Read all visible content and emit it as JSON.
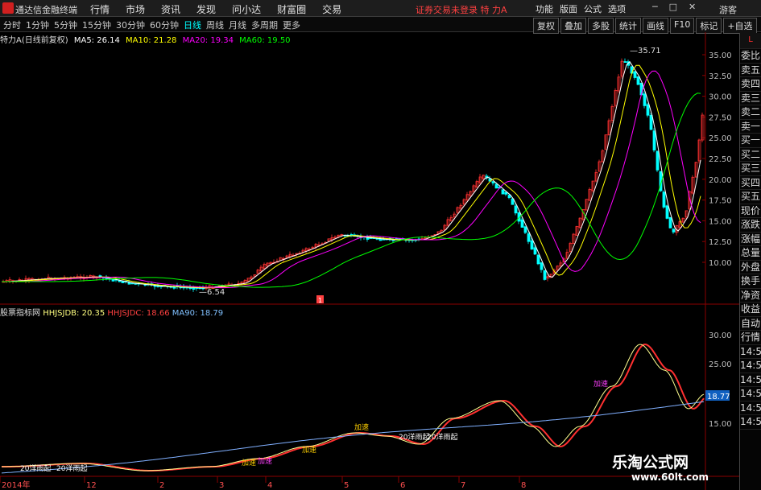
{
  "titlebar": {
    "app_name": "通达信金融终端",
    "menu": [
      "行情",
      "市场",
      "资讯",
      "发现",
      "问小达",
      "财富圈",
      "交易"
    ],
    "status": "证券交易未登录  特 力A",
    "right_tools": [
      "功能",
      "版面",
      "公式",
      "选项"
    ],
    "guest": "游客"
  },
  "periods": {
    "items": [
      "分时",
      "1分钟",
      "5分钟",
      "15分钟",
      "30分钟",
      "60分钟",
      "日线",
      "周线",
      "月线",
      "多周期",
      "更多"
    ],
    "active": "日线"
  },
  "toolbar": [
    "复权",
    "叠加",
    "多股",
    "统计",
    "画线",
    "F10",
    "标记",
    "+自选"
  ],
  "main_info": {
    "stock": "特力A(日线前复权)",
    "ma5": "MA5: 26.14",
    "ma10": "MA10: 21.28",
    "ma20": "MA20: 19.34",
    "ma60": "MA60: 19.50"
  },
  "indicator_info": {
    "name": "股票指标网",
    "hhjsjdb": "HHJSJDB: 20.35",
    "hhjsjdc": "HHJSJDC: 18.66",
    "ma90": "MA90: 18.79"
  },
  "price_axis": [
    "35.00",
    "32.50",
    "30.00",
    "27.50",
    "25.00",
    "22.50",
    "20.00",
    "17.50",
    "15.00",
    "12.50",
    "10.00"
  ],
  "indicator_axis": [
    "30.00",
    "25.00",
    "18.77",
    "15.00"
  ],
  "annotations": {
    "high": "35.71",
    "low": "6.54",
    "marker": "1"
  },
  "signal_labels": [
    "加速",
    "加速",
    "加速",
    "加速",
    "20洋雨起",
    "20洋雨起",
    "20洋雨起",
    "20洋雨起",
    "加速"
  ],
  "x_axis": [
    "2014年",
    "12",
    "2",
    "3",
    "4",
    "5",
    "6",
    "7",
    "8"
  ],
  "sidebar": [
    "L",
    "委比",
    "卖五",
    "卖四",
    "卖三",
    "卖二",
    "卖一",
    "买一",
    "买二",
    "买三",
    "买四",
    "买五",
    "现价",
    "涨跌",
    "涨幅",
    "总量",
    "外盘",
    "换手",
    "净资",
    "收益",
    "自动",
    "行情",
    "14:55",
    "14:55",
    "14:56",
    "14:56",
    "14:56",
    "14:56"
  ],
  "watermark": {
    "title": "乐淘公式网",
    "url": "www.60lt.com"
  },
  "colors": {
    "up": "#ff3030",
    "down": "#00ffff",
    "ma5": "#ffffff",
    "ma10": "#ffff00",
    "ma20": "#ff00ff",
    "ma60": "#00ff00"
  }
}
